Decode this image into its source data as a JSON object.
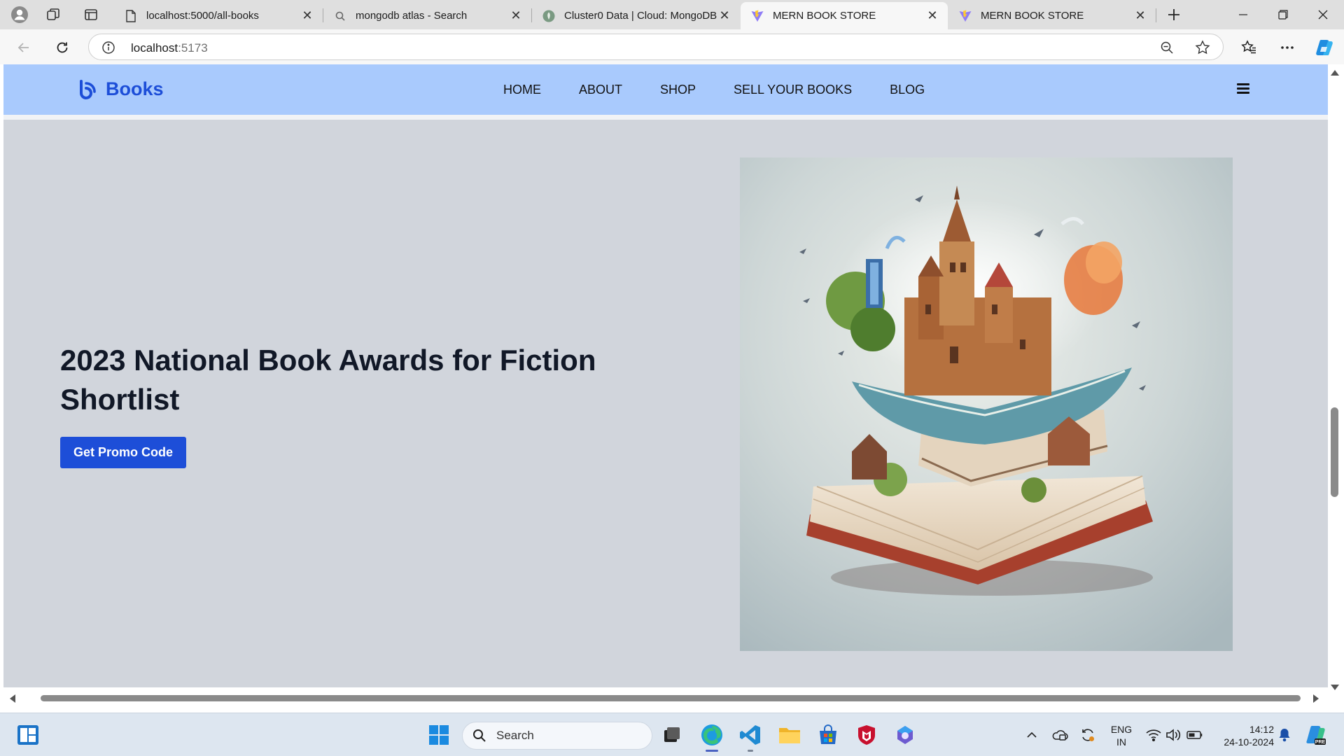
{
  "browser": {
    "tabs": [
      {
        "title": "localhost:5000/all-books",
        "icon": "page-icon"
      },
      {
        "title": "mongodb atlas - Search",
        "icon": "search-icon"
      },
      {
        "title": "Cluster0 Data | Cloud: MongoDB C",
        "icon": "mongodb-leaf-icon"
      },
      {
        "title": "MERN BOOK STORE",
        "icon": "vite-icon",
        "active": true
      },
      {
        "title": "MERN BOOK STORE",
        "icon": "vite-icon"
      }
    ],
    "address": {
      "host": "localhost",
      "port": ":5173"
    }
  },
  "site": {
    "brand": "Books",
    "nav": [
      "HOME",
      "ABOUT",
      "SHOP",
      "SELL YOUR BOOKS",
      "BLOG"
    ],
    "colors": {
      "nav_bg": "#a9cafd",
      "brand": "#1d4ed8",
      "page_bg": "#d1d5dc",
      "button_bg": "#1d4ed8"
    }
  },
  "hero": {
    "title": "2023 National Book Awards for Fiction Shortlist",
    "button": "Get Promo Code",
    "image": "open-book-fantasy-castle-illustration"
  },
  "taskbar": {
    "search_placeholder": "Search",
    "language": [
      "ENG",
      "IN"
    ],
    "time": "14:12",
    "date": "24-10-2024"
  }
}
